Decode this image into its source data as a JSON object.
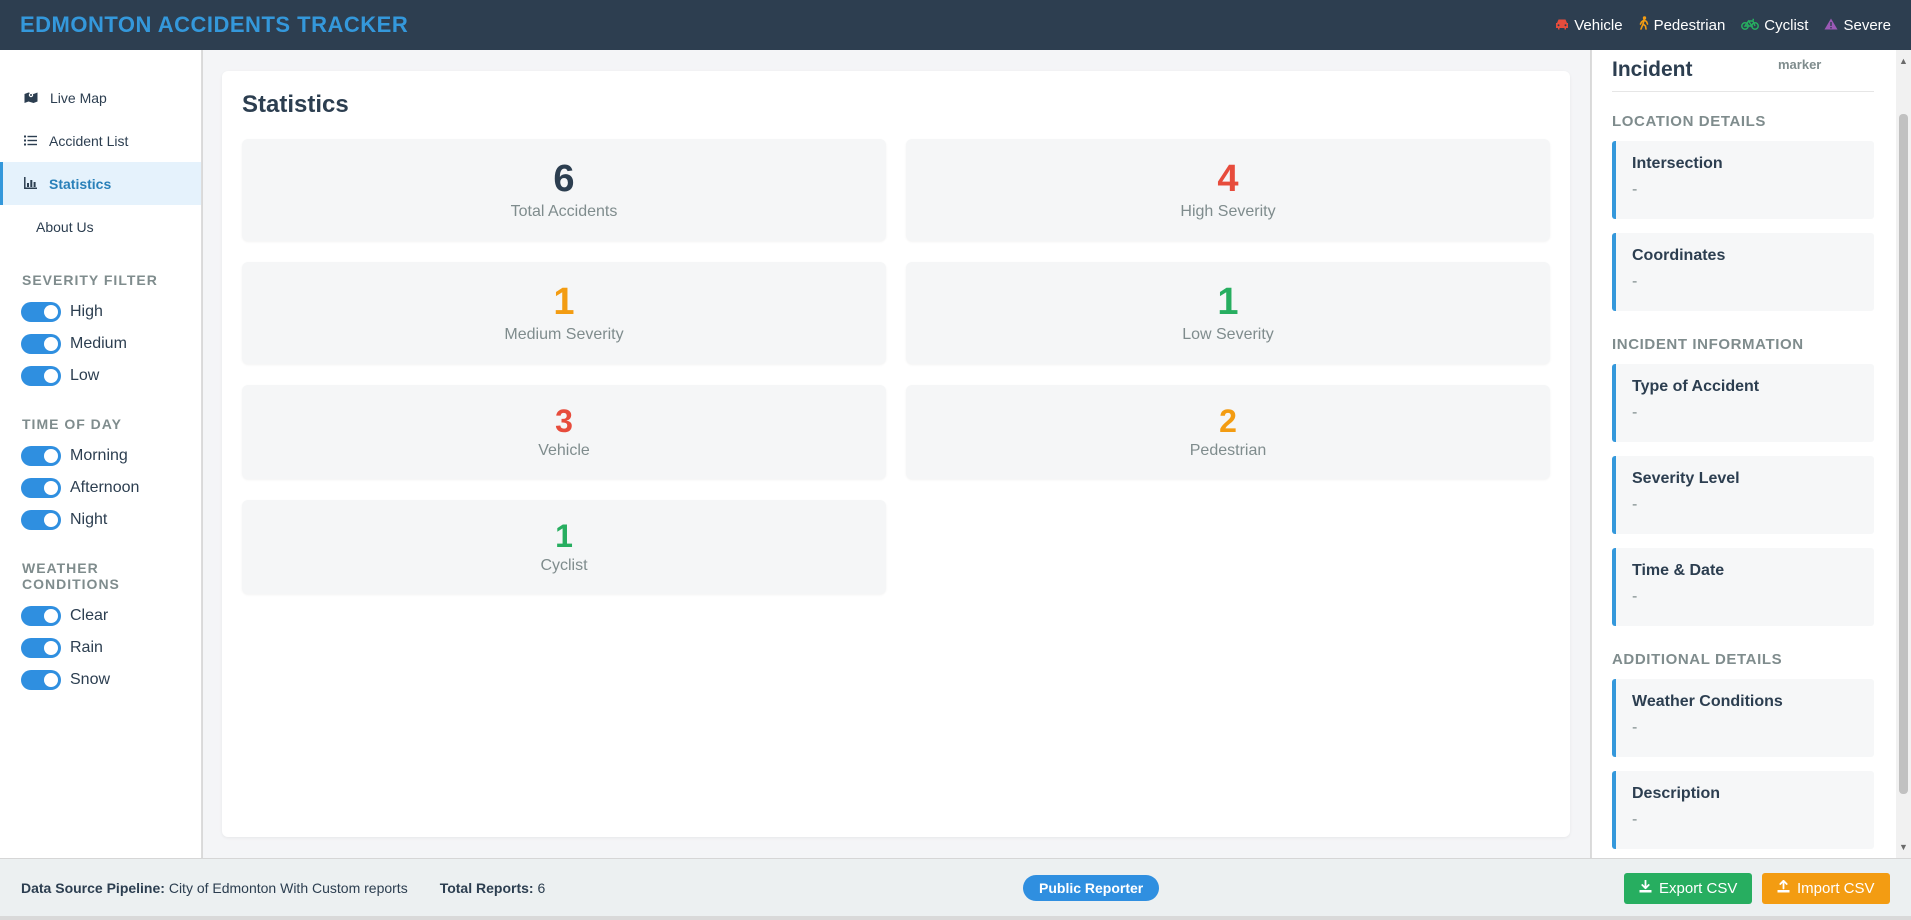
{
  "app": {
    "title": "EDMONTON ACCIDENTS TRACKER",
    "legend": [
      {
        "label": "Vehicle",
        "icon": "car-icon",
        "color": "#e74c3c"
      },
      {
        "label": "Pedestrian",
        "icon": "walking-person-icon",
        "color": "#f39c12"
      },
      {
        "label": "Cyclist",
        "icon": "bicycle-icon",
        "color": "#27ae60"
      },
      {
        "label": "Severe",
        "icon": "warning-triangle-icon",
        "color": "#9b59b6"
      }
    ]
  },
  "sidebar": {
    "nav": [
      {
        "label": "Live Map",
        "icon": "map-icon"
      },
      {
        "label": "Accident List",
        "icon": "list-icon"
      },
      {
        "label": "Statistics",
        "icon": "chart-icon",
        "active": true
      },
      {
        "label": "About Us"
      }
    ],
    "severity_filter": {
      "title": "SEVERITY FILTER",
      "options": [
        "High",
        "Medium",
        "Low"
      ]
    },
    "time_of_day": {
      "title": "TIME OF DAY",
      "options": [
        "Morning",
        "Afternoon",
        "Night"
      ]
    },
    "weather": {
      "title": "WEATHER CONDITIONS",
      "options": [
        "Clear",
        "Rain",
        "Snow"
      ]
    }
  },
  "main": {
    "title": "Statistics",
    "stats": [
      {
        "value": "6",
        "label": "Total Accidents",
        "color": "#2c3e50"
      },
      {
        "value": "4",
        "label": "High Severity",
        "color": "#e74c3c"
      },
      {
        "value": "1",
        "label": "Medium Severity",
        "color": "#f39c12"
      },
      {
        "value": "1",
        "label": "Low Severity",
        "color": "#27ae60"
      },
      {
        "value": "3",
        "label": "Vehicle",
        "color": "#e74c3c"
      },
      {
        "value": "2",
        "label": "Pedestrian",
        "color": "#f39c12"
      },
      {
        "value": "1",
        "label": "Cyclist",
        "color": "#27ae60"
      }
    ]
  },
  "panel": {
    "title": "Incident",
    "note": "marker",
    "sections": {
      "location": "LOCATION DETAILS",
      "incident": "INCIDENT INFORMATION",
      "additional": "ADDITIONAL DETAILS"
    },
    "details": [
      {
        "label": "Intersection",
        "value": "-"
      },
      {
        "label": "Coordinates",
        "value": "-"
      },
      {
        "label": "Type of Accident",
        "value": "-"
      },
      {
        "label": "Severity Level",
        "value": "-"
      },
      {
        "label": "Time & Date",
        "value": "-"
      },
      {
        "label": "Weather Conditions",
        "value": "-"
      },
      {
        "label": "Description",
        "value": "-"
      }
    ]
  },
  "footer": {
    "source_label": "Data Source Pipeline:",
    "source_value": "City of Edmonton With Custom reports",
    "total_label": "Total Reports:",
    "total_value": "6",
    "reporter_button": "Public Reporter",
    "export_button": "Export CSV",
    "import_button": "Import CSV"
  }
}
